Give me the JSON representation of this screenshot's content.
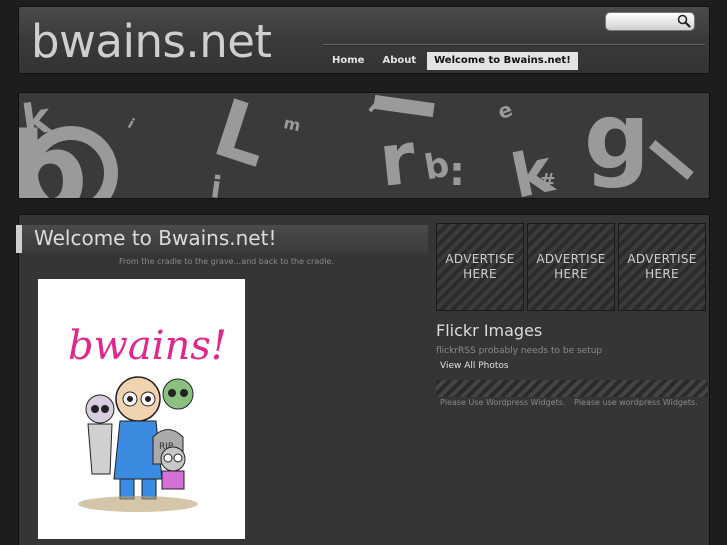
{
  "header": {
    "logo": "bwains.net",
    "search": {
      "value": "",
      "placeholder": ""
    },
    "nav": [
      {
        "label": "Home"
      },
      {
        "label": "About"
      },
      {
        "label": "Welcome to Bwains.net!"
      }
    ]
  },
  "banner": {
    "letters": [
      "k",
      "b",
      "L",
      "m",
      "r",
      "b",
      "i",
      "k",
      "#",
      "g",
      "i",
      "e",
      ":",
      "r"
    ]
  },
  "post": {
    "title": "Welcome to Bwains.net!",
    "subtitle": "From the cradle to the grave...and back to the cradle.",
    "image": {
      "logo_text": "bwains!",
      "tombstone_text": "RIP"
    }
  },
  "sidebar": {
    "ads": [
      {
        "line1": "ADVERTISE",
        "line2": "HERE"
      },
      {
        "line1": "ADVERTISE",
        "line2": "HERE"
      },
      {
        "line1": "ADVERTISE",
        "line2": "HERE"
      }
    ],
    "flickr_title": "Flickr Images",
    "flickr_note": "flickrRSS probably needs to be setup",
    "flickr_link": "View All Photos",
    "widget_note_1": "Please Use Wordpress Widgets.",
    "widget_note_2": "Please use wordpress Widgets."
  },
  "colors": {
    "background": "#1d1d1d",
    "panel": "#353535",
    "text_light": "#dcdcdc",
    "text_muted": "#8a8a8a",
    "nav_active": "#e3e3e3",
    "logo_pink": "#e0288a",
    "zombie_blue": "#3b8be0",
    "zombie_green": "#8ac080"
  },
  "icons": {
    "search": "magnifier-icon"
  }
}
